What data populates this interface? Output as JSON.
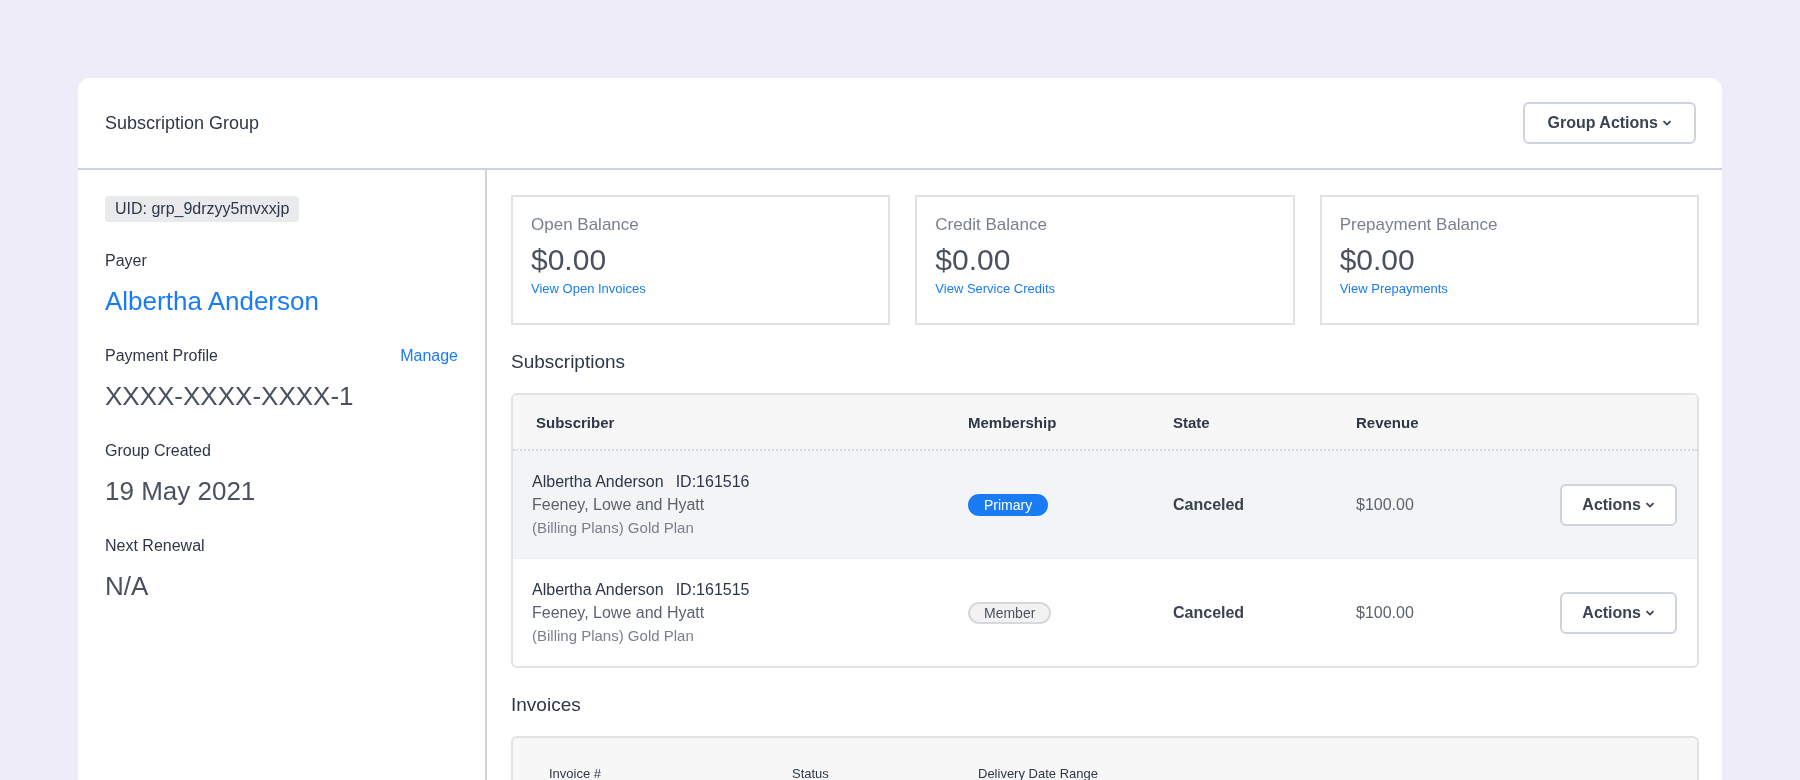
{
  "header": {
    "title": "Subscription Group",
    "action_button": "Group Actions"
  },
  "sidebar": {
    "uid": "UID: grp_9drzyy5mvxxjp",
    "fields": [
      {
        "label": "Payer",
        "value": "Albertha Anderson",
        "kind": "link"
      },
      {
        "label": "Payment Profile",
        "value": "XXXX-XXXX-XXXX-1",
        "kind": "text",
        "action": "Manage"
      },
      {
        "label": "Group Created",
        "value": "19 May 2021",
        "kind": "text"
      },
      {
        "label": "Next Renewal",
        "value": "N/A",
        "kind": "text"
      }
    ]
  },
  "balances": [
    {
      "label": "Open Balance",
      "amount": "$0.00",
      "link": "View Open Invoices"
    },
    {
      "label": "Credit Balance",
      "amount": "$0.00",
      "link": "View Service Credits"
    },
    {
      "label": "Prepayment Balance",
      "amount": "$0.00",
      "link": "View Prepayments"
    }
  ],
  "subscriptions": {
    "title": "Subscriptions",
    "columns": [
      "Subscriber",
      "Membership",
      "State",
      "Revenue"
    ],
    "rows": [
      {
        "name": "Albertha Anderson",
        "id": "ID:161516",
        "company": "Feeney, Lowe and Hyatt",
        "plan": "(Billing Plans) Gold Plan",
        "membership": {
          "label": "Primary",
          "kind": "primary"
        },
        "state": "Canceled",
        "revenue": "$100.00",
        "action": "Actions",
        "highlighted": true
      },
      {
        "name": "Albertha Anderson",
        "id": "ID:161515",
        "company": "Feeney, Lowe and Hyatt",
        "plan": "(Billing Plans) Gold Plan",
        "membership": {
          "label": "Member",
          "kind": "member"
        },
        "state": "Canceled",
        "revenue": "$100.00",
        "action": "Actions",
        "highlighted": false
      }
    ]
  },
  "invoices": {
    "title": "Invoices",
    "columns": [
      "Invoice #",
      "Status",
      "Delivery Date Range"
    ]
  }
}
